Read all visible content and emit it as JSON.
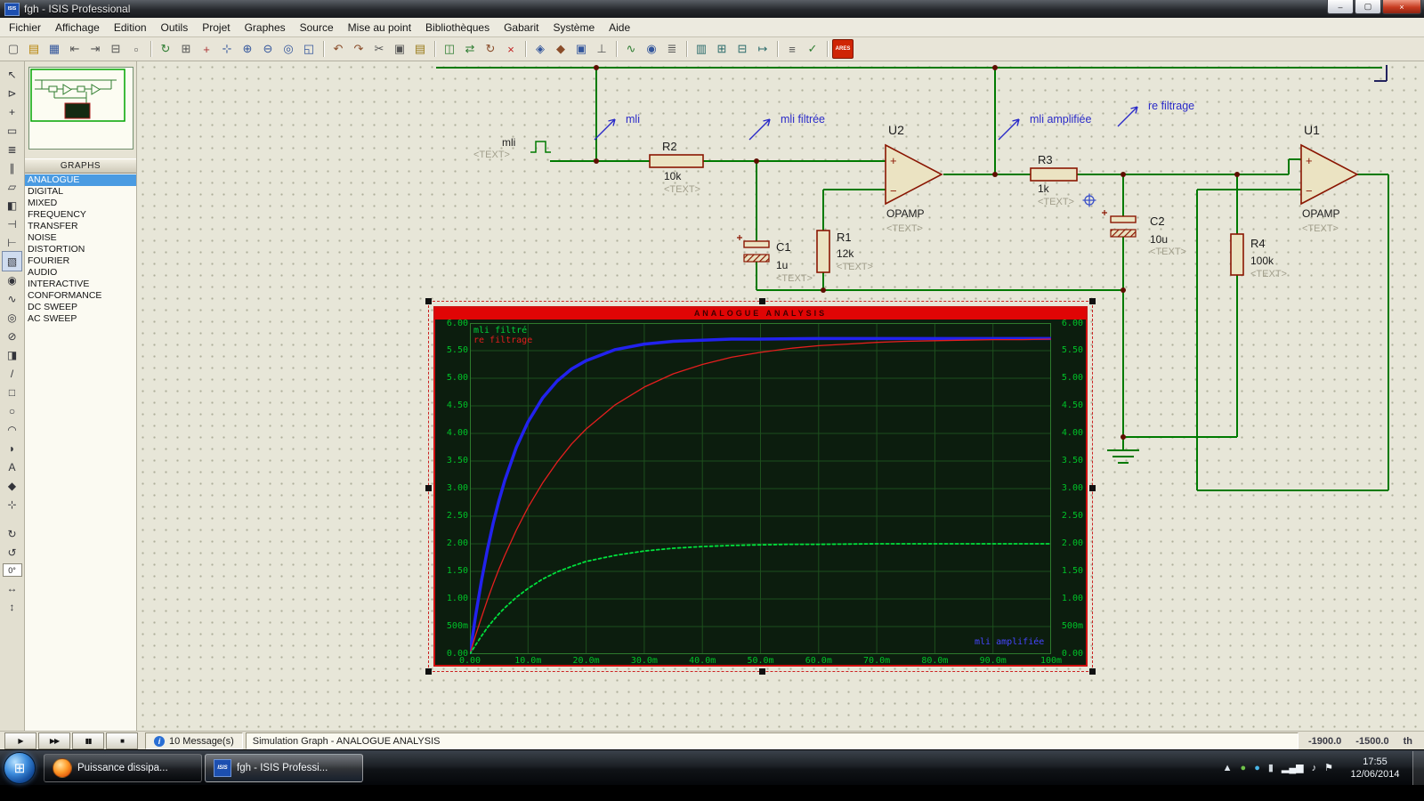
{
  "window": {
    "title": "fgh - ISIS Professional",
    "icon_text": "ISIS",
    "controls": {
      "minimize": "–",
      "maximize": "▢",
      "close": "×"
    }
  },
  "menu": {
    "items": [
      "Fichier",
      "Affichage",
      "Edition",
      "Outils",
      "Projet",
      "Graphes",
      "Source",
      "Mise au point",
      "Bibliothèques",
      "Gabarit",
      "Système",
      "Aide"
    ]
  },
  "toolbar": {
    "icons": [
      {
        "name": "new-design",
        "glyph": "▢",
        "color": "#555"
      },
      {
        "name": "open-design",
        "glyph": "▤",
        "color": "#b8860b"
      },
      {
        "name": "save-design",
        "glyph": "▦",
        "color": "#33569c"
      },
      {
        "name": "import-section",
        "glyph": "⇤",
        "color": "#555"
      },
      {
        "name": "export-section",
        "glyph": "⇥",
        "color": "#555"
      },
      {
        "name": "print-design",
        "glyph": "⊟",
        "color": "#555"
      },
      {
        "name": "mark-output-area",
        "glyph": "▫",
        "color": "#555"
      },
      {
        "sep": true
      },
      {
        "name": "redraw-display",
        "glyph": "↻",
        "color": "#2e7d32"
      },
      {
        "name": "toggle-grid",
        "glyph": "⊞",
        "color": "#555"
      },
      {
        "name": "origin",
        "glyph": "+",
        "color": "#a33"
      },
      {
        "name": "center-at-cursor",
        "glyph": "⊹",
        "color": "#33569c"
      },
      {
        "name": "zoom-in",
        "glyph": "⊕",
        "color": "#33569c"
      },
      {
        "name": "zoom-out",
        "glyph": "⊖",
        "color": "#33569c"
      },
      {
        "name": "zoom-all",
        "glyph": "◎",
        "color": "#33569c"
      },
      {
        "name": "zoom-area",
        "glyph": "◱",
        "color": "#33569c"
      },
      {
        "sep": true
      },
      {
        "name": "undo",
        "glyph": "↶",
        "color": "#8a4d2a"
      },
      {
        "name": "redo",
        "glyph": "↷",
        "color": "#8a4d2a"
      },
      {
        "name": "cut",
        "glyph": "✂",
        "color": "#555"
      },
      {
        "name": "copy",
        "glyph": "▣",
        "color": "#555"
      },
      {
        "name": "paste",
        "glyph": "▤",
        "color": "#9a7b1a"
      },
      {
        "sep": true
      },
      {
        "name": "block-copy",
        "glyph": "◫",
        "color": "#2e7d32"
      },
      {
        "name": "block-move",
        "glyph": "⇄",
        "color": "#2e7d32"
      },
      {
        "name": "block-rotate",
        "glyph": "↻",
        "color": "#8a4d2a"
      },
      {
        "name": "block-delete",
        "glyph": "×",
        "color": "#c22222"
      },
      {
        "sep": true
      },
      {
        "name": "pick-parts",
        "glyph": "◈",
        "color": "#33569c"
      },
      {
        "name": "make-device",
        "glyph": "◆",
        "color": "#8a4d2a"
      },
      {
        "name": "packaging-tool",
        "glyph": "▣",
        "color": "#33569c"
      },
      {
        "name": "decompose",
        "glyph": "⊥",
        "color": "#555"
      },
      {
        "sep": true
      },
      {
        "name": "wire-autorouter",
        "glyph": "∿",
        "color": "#2e7d32"
      },
      {
        "name": "search-tag",
        "glyph": "◉",
        "color": "#33569c"
      },
      {
        "name": "property-assignment",
        "glyph": "≣",
        "color": "#555"
      },
      {
        "sep": true
      },
      {
        "name": "design-explorer",
        "glyph": "▥",
        "color": "#2a6b6b"
      },
      {
        "name": "new-sheet",
        "glyph": "⊞",
        "color": "#2a6b6b"
      },
      {
        "name": "remove-sheet",
        "glyph": "⊟",
        "color": "#2a6b6b"
      },
      {
        "name": "goto-sheet",
        "glyph": "↦",
        "color": "#2a6b6b"
      },
      {
        "sep": true
      },
      {
        "name": "bill-of-materials",
        "glyph": "≡",
        "color": "#555"
      },
      {
        "name": "electrical-rule-check",
        "glyph": "✓",
        "color": "#2e7d32"
      },
      {
        "sep": true
      },
      {
        "name": "netlist-to-ares",
        "glyph": "ARES",
        "cls": "ares"
      }
    ]
  },
  "toolbox": {
    "active": "graph-mode",
    "icons": [
      {
        "name": "selection-pointer",
        "glyph": "↖"
      },
      {
        "name": "component-mode",
        "glyph": "⊳"
      },
      {
        "name": "junction-dot-mode",
        "glyph": "+"
      },
      {
        "name": "wire-label-mode",
        "glyph": "▭"
      },
      {
        "name": "text-script-mode",
        "glyph": "≣"
      },
      {
        "name": "bus-mode",
        "glyph": "∥"
      },
      {
        "name": "subcircuit-mode",
        "glyph": "▱"
      },
      {
        "name": "instant-edit-mode",
        "glyph": "◧"
      },
      {
        "name": "terminal-mode",
        "glyph": "⊣"
      },
      {
        "name": "device-pin-mode",
        "glyph": "⊢"
      },
      {
        "name": "graph-mode",
        "glyph": "▧"
      },
      {
        "name": "tape-recorder-mode",
        "glyph": "◉"
      },
      {
        "name": "generator-mode",
        "glyph": "∿"
      },
      {
        "name": "voltage-probe-mode",
        "glyph": "◎"
      },
      {
        "name": "current-probe-mode",
        "glyph": "⊘"
      },
      {
        "name": "virtual-instrument-mode",
        "glyph": "◨"
      },
      {
        "name": "2d-line-mode",
        "glyph": "/"
      },
      {
        "name": "2d-box-mode",
        "glyph": "□"
      },
      {
        "name": "2d-circle-mode",
        "glyph": "○"
      },
      {
        "name": "2d-arc-mode",
        "glyph": "◠"
      },
      {
        "name": "2d-path-mode",
        "glyph": "◗"
      },
      {
        "name": "2d-text-mode",
        "glyph": "A"
      },
      {
        "name": "2d-symbol-mode",
        "glyph": "◆"
      },
      {
        "name": "2d-marker-mode",
        "glyph": "⊹"
      }
    ],
    "rotate_icons": [
      {
        "name": "rotate-clockwise-button",
        "glyph": "↻"
      },
      {
        "name": "rotate-anticlockwise-button",
        "glyph": "↺"
      }
    ],
    "angle": "0°",
    "mirror_icons": [
      {
        "name": "mirror-x-button",
        "glyph": "↔"
      },
      {
        "name": "mirror-y-button",
        "glyph": "↕"
      }
    ]
  },
  "left_panel": {
    "header": "GRAPHS",
    "selected": "ANALOGUE",
    "graph_types": [
      "ANALOGUE",
      "DIGITAL",
      "MIXED",
      "FREQUENCY",
      "TRANSFER",
      "NOISE",
      "DISTORTION",
      "FOURIER",
      "AUDIO",
      "INTERACTIVE",
      "CONFORMANCE",
      "DC SWEEP",
      "AC SWEEP"
    ]
  },
  "schematic": {
    "source": {
      "ref": "mli",
      "text": "<TEXT>"
    },
    "components": {
      "r2": {
        "ref": "R2",
        "value": "10k",
        "text": "<TEXT>"
      },
      "r1": {
        "ref": "R1",
        "value": "12k",
        "text": "<TEXT>"
      },
      "r3": {
        "ref": "R3",
        "value": "1k",
        "text": "<TEXT>"
      },
      "r4": {
        "ref": "R4",
        "value": "100k",
        "text": "<TEXT>"
      },
      "c1": {
        "ref": "C1",
        "value": "1u",
        "text": "<TEXT>"
      },
      "c2": {
        "ref": "C2",
        "value": "10u",
        "text": "<TEXT>"
      },
      "u2": {
        "ref": "U2",
        "value": "OPAMP",
        "text": "<TEXT>"
      },
      "u1": {
        "ref": "U1",
        "value": "OPAMP",
        "text": "<TEXT>"
      }
    },
    "annotations": [
      {
        "label": "mli"
      },
      {
        "label": "mli filtrée"
      },
      {
        "label": "mli amplifiée"
      },
      {
        "label": "re filtrage"
      }
    ],
    "opamp_symbols": {
      "plus": "+",
      "minus": "−"
    }
  },
  "graph_window": {
    "title": "ANALOGUE ANALYSIS",
    "chart_data": {
      "type": "line",
      "title": "ANALOGUE ANALYSIS",
      "x_unit": "ms",
      "xlim": [
        0,
        100
      ],
      "ylim": [
        0,
        6
      ],
      "grid": true,
      "background": "#0c1d0e",
      "x_ticks": [
        [
          "0.00",
          0
        ],
        [
          "10.0m",
          10
        ],
        [
          "20.0m",
          20
        ],
        [
          "30.0m",
          30
        ],
        [
          "40.0m",
          40
        ],
        [
          "50.0m",
          50
        ],
        [
          "60.0m",
          60
        ],
        [
          "70.0m",
          70
        ],
        [
          "80.0m",
          80
        ],
        [
          "90.0m",
          90
        ],
        [
          "100m",
          100
        ]
      ],
      "y_ticks": [
        [
          "0.00",
          0
        ],
        [
          "500m",
          0.5
        ],
        [
          "1.00",
          1
        ],
        [
          "1.50",
          1.5
        ],
        [
          "2.00",
          2
        ],
        [
          "2.50",
          2.5
        ],
        [
          "3.00",
          3
        ],
        [
          "3.50",
          3.5
        ],
        [
          "4.00",
          4
        ],
        [
          "4.50",
          4.5
        ],
        [
          "5.00",
          5
        ],
        [
          "5.50",
          5.5
        ],
        [
          "6.00",
          6
        ]
      ],
      "legend_top_left": [
        {
          "label": "mli filtré",
          "color": "#00d23c"
        },
        {
          "label": "re filtrage",
          "color": "#e41e1e"
        }
      ],
      "legend_bottom_right": {
        "label": "mli amplifiée",
        "color": "#4646ff"
      },
      "series": [
        {
          "name": "mli amplifiée",
          "color": "#2222ee",
          "width": 3.5,
          "points": [
            [
              0,
              0
            ],
            [
              1,
              0.71
            ],
            [
              2,
              1.34
            ],
            [
              3,
              1.89
            ],
            [
              4,
              2.37
            ],
            [
              5,
              2.78
            ],
            [
              6,
              3.15
            ],
            [
              8,
              3.75
            ],
            [
              10,
              4.21
            ],
            [
              12.5,
              4.64
            ],
            [
              15,
              4.95
            ],
            [
              17.5,
              5.17
            ],
            [
              20,
              5.32
            ],
            [
              25,
              5.52
            ],
            [
              30,
              5.62
            ],
            [
              35,
              5.67
            ],
            [
              40,
              5.69
            ],
            [
              45,
              5.71
            ],
            [
              50,
              5.71
            ],
            [
              60,
              5.72
            ],
            [
              70,
              5.72
            ],
            [
              80,
              5.72
            ],
            [
              90,
              5.72
            ],
            [
              100,
              5.72
            ]
          ]
        },
        {
          "name": "re filtrage",
          "color": "#e41e1e",
          "width": 1.3,
          "points": [
            [
              0,
              0
            ],
            [
              1,
              0.35
            ],
            [
              2,
              0.67
            ],
            [
              3,
              0.98
            ],
            [
              4,
              1.27
            ],
            [
              5,
              1.54
            ],
            [
              6,
              1.79
            ],
            [
              8,
              2.25
            ],
            [
              10,
              2.66
            ],
            [
              12.5,
              3.1
            ],
            [
              15,
              3.48
            ],
            [
              17.5,
              3.81
            ],
            [
              20,
              4.08
            ],
            [
              25,
              4.52
            ],
            [
              30,
              4.84
            ],
            [
              35,
              5.08
            ],
            [
              40,
              5.25
            ],
            [
              45,
              5.38
            ],
            [
              50,
              5.47
            ],
            [
              55,
              5.54
            ],
            [
              60,
              5.59
            ],
            [
              65,
              5.62
            ],
            [
              70,
              5.65
            ],
            [
              75,
              5.67
            ],
            [
              80,
              5.68
            ],
            [
              85,
              5.69
            ],
            [
              90,
              5.7
            ],
            [
              95,
              5.7
            ],
            [
              100,
              5.71
            ]
          ]
        },
        {
          "name": "mli filtré",
          "color": "#00e03c",
          "width": 1.8,
          "dash": "3 3",
          "points": [
            [
              0,
              0
            ],
            [
              1,
              0.17
            ],
            [
              2,
              0.33
            ],
            [
              3,
              0.48
            ],
            [
              4,
              0.61
            ],
            [
              5,
              0.73
            ],
            [
              6,
              0.84
            ],
            [
              8,
              1.03
            ],
            [
              10,
              1.19
            ],
            [
              12.5,
              1.36
            ],
            [
              15,
              1.49
            ],
            [
              17.5,
              1.59
            ],
            [
              20,
              1.68
            ],
            [
              25,
              1.79
            ],
            [
              30,
              1.87
            ],
            [
              35,
              1.92
            ],
            [
              40,
              1.95
            ],
            [
              45,
              1.97
            ],
            [
              50,
              1.98
            ],
            [
              55,
              1.99
            ],
            [
              60,
              1.99
            ],
            [
              70,
              2.0
            ],
            [
              80,
              2.0
            ],
            [
              90,
              2.0
            ],
            [
              100,
              2.0
            ]
          ]
        }
      ]
    }
  },
  "status_bar": {
    "sim_buttons": [
      {
        "name": "play-button",
        "glyph": "▶"
      },
      {
        "name": "step-button",
        "glyph": "▶▶"
      },
      {
        "name": "pause-button",
        "glyph": "▮▮"
      },
      {
        "name": "stop-button",
        "glyph": "■"
      }
    ],
    "info_icon": "i",
    "messages": "10 Message(s)",
    "status": "Simulation Graph - ANALOGUE ANALYSIS",
    "coord_x": "-1900.0",
    "coord_y": "-1500.0",
    "coord_units": "th"
  },
  "taskbar": {
    "start_icon": "⊞",
    "firefox_label": "Puissance dissipa...",
    "isis_icon_text": "ISIS",
    "isis_label": "fgh - ISIS Professi...",
    "tray_icons": [
      {
        "name": "hidden-icons-chevron",
        "glyph": "▲",
        "color": "#dfe6ec"
      },
      {
        "name": "security-tray-icon",
        "glyph": "●",
        "color": "#6fc24a"
      },
      {
        "name": "messenger-tray-icon",
        "glyph": "●",
        "color": "#49b6e8"
      },
      {
        "name": "device-tray-icon",
        "glyph": "▮",
        "color": "#cfd6dc"
      },
      {
        "name": "network-tray-icon",
        "glyph": "▂▄▆",
        "color": "#eef3f8"
      },
      {
        "name": "volume-tray-icon",
        "glyph": "♪",
        "color": "#eef3f8"
      },
      {
        "name": "action-center-icon",
        "glyph": "⚑",
        "color": "#eef3f8"
      }
    ],
    "time": "17:55",
    "date": "12/06/2014"
  }
}
